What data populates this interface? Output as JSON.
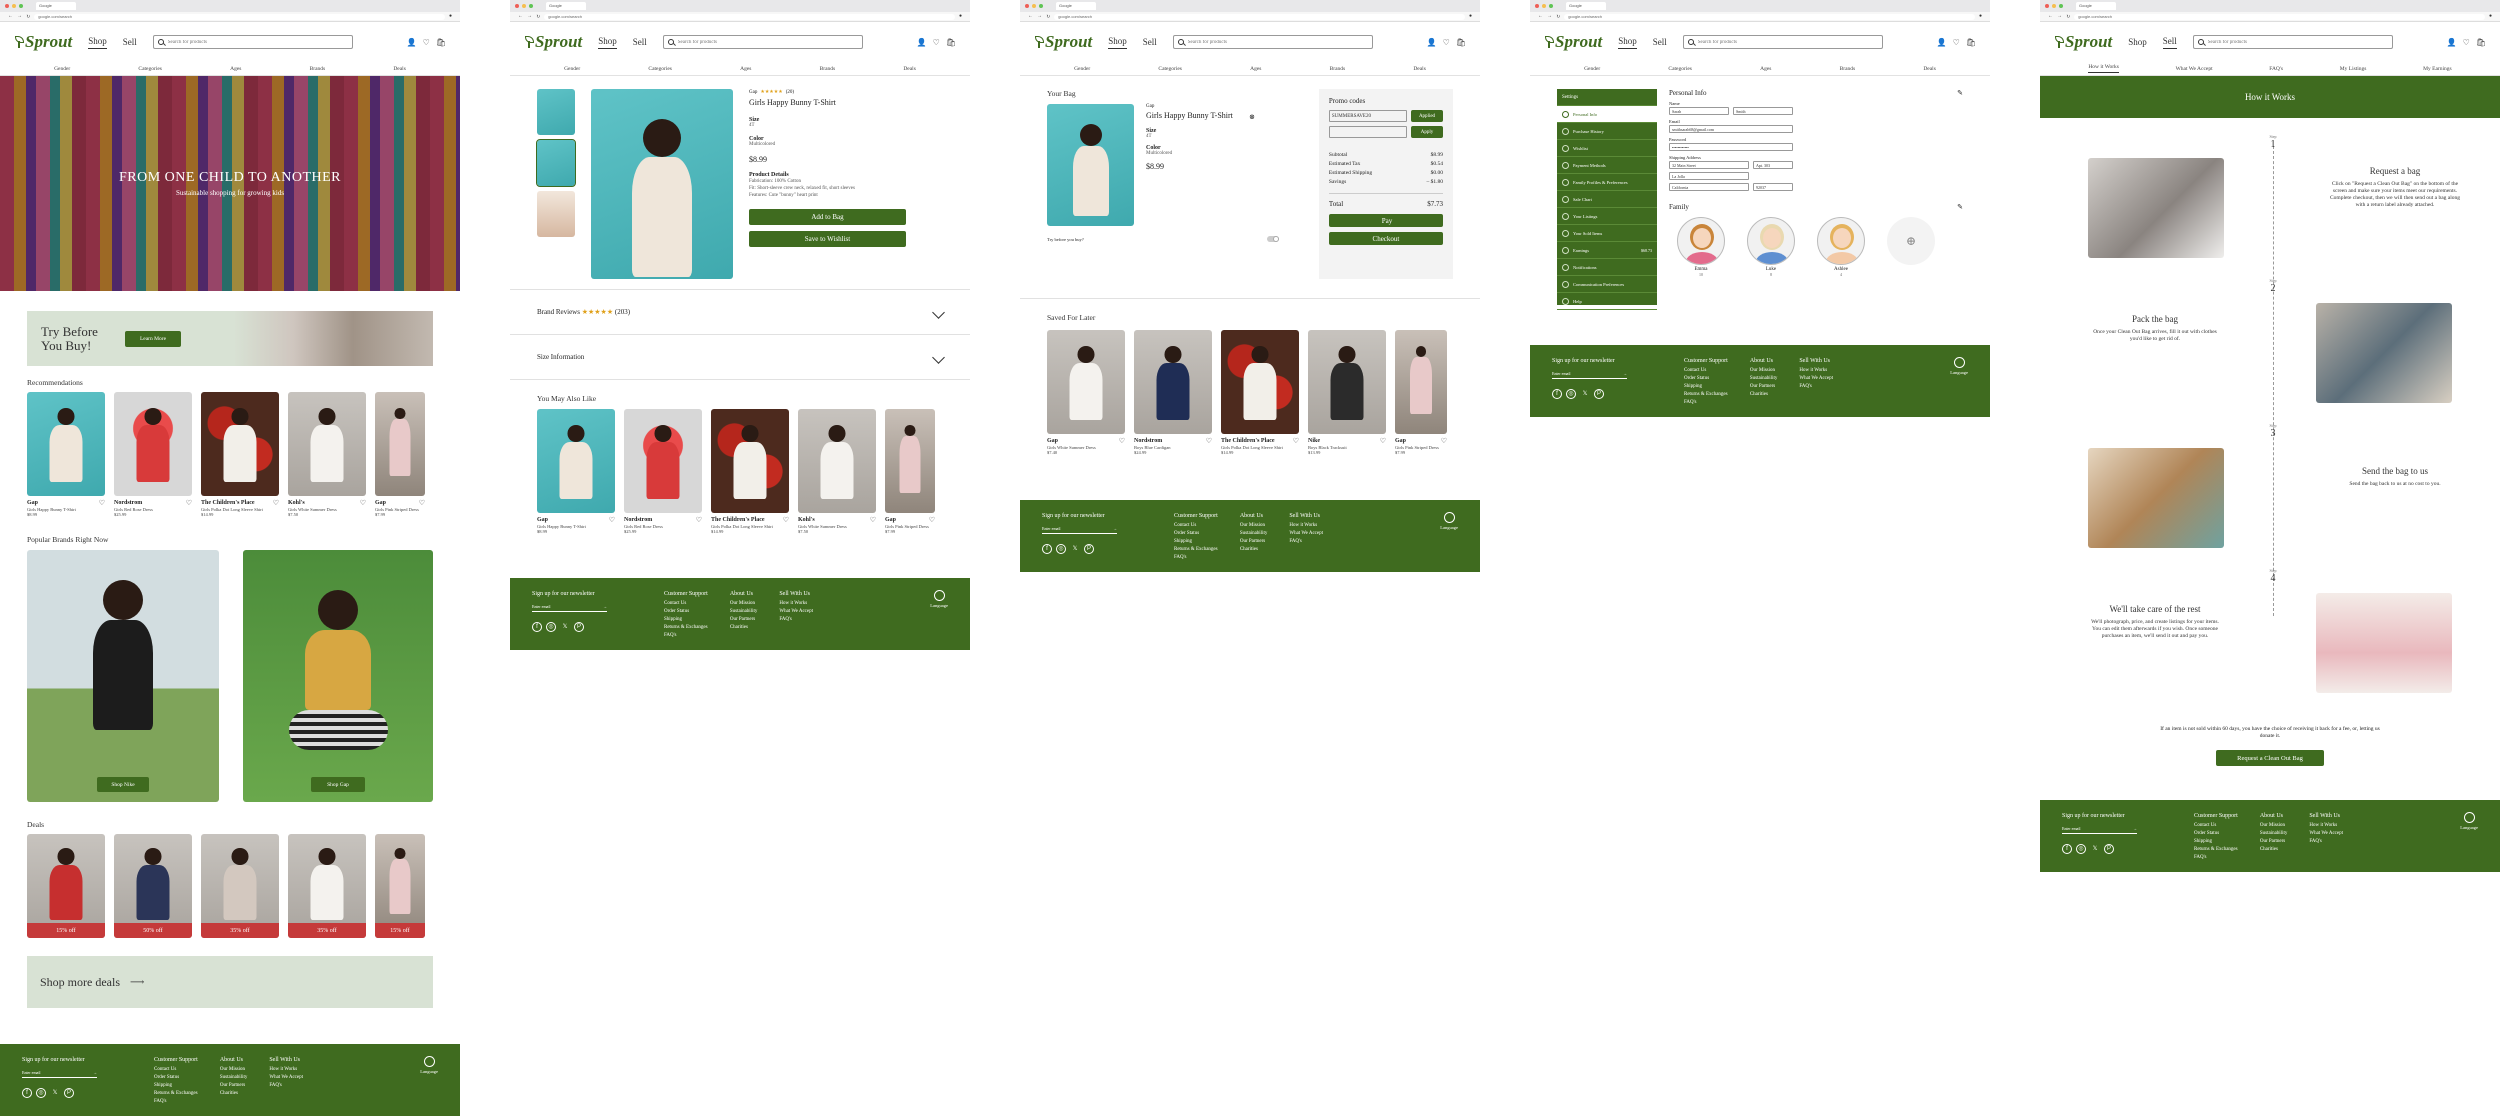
{
  "browser": {
    "tab_label": "Google",
    "url": "google.com/search"
  },
  "header": {
    "logo": "Sprout",
    "nav_shop": "Shop",
    "nav_sell": "Sell",
    "search_placeholder": "Search for products"
  },
  "category_nav": [
    "Gender",
    "Categories",
    "Ages",
    "Brands",
    "Deals"
  ],
  "sell_nav": [
    "How it Works",
    "What We Accept",
    "FAQ's",
    "My Listings",
    "My Earnings"
  ],
  "home": {
    "hero_title": "FROM ONE CHILD TO ANOTHER",
    "hero_subtitle": "Sustainable shopping for growing kids",
    "try_title": "Try Before You Buy!",
    "try_button": "Learn More",
    "recommendations_title": "Recommendations",
    "recommendations": [
      {
        "brand": "Gap",
        "name": "Girls Happy Bunny T-Shirt",
        "price": "$8.99"
      },
      {
        "brand": "Nordstrom",
        "name": "Girls Red Rose Dress",
        "price": "$25.99"
      },
      {
        "brand": "The Children's Place",
        "name": "Girls Polka Dot Long Sleeve Shirt",
        "price": "$14.99"
      },
      {
        "brand": "Kohl's",
        "name": "Girls White Summer Dress",
        "price": "$7.50"
      },
      {
        "brand": "Gap",
        "name": "Girls Pink Striped Dress",
        "price": "$7.99"
      }
    ],
    "popular_title": "Popular Brands Right Now",
    "brand_buttons": [
      "Shop Nike",
      "Shop Gap"
    ],
    "deals_title": "Deals",
    "deals": [
      "15% off",
      "50% off",
      "35% off",
      "35% off",
      "15% off"
    ],
    "shop_more": "Shop more deals"
  },
  "product": {
    "brand": "Gap",
    "rating_count": "(20)",
    "title": "Girls Happy Bunny T-Shirt",
    "size_label": "Size",
    "size_value": "4T",
    "color_label": "Color",
    "color_value": "Multicolored",
    "price": "$8.99",
    "details_label": "Product Details",
    "details": [
      "Fabrication: 100% Cotton",
      "Fit: Short-sleeve crew neck, relaxed fit, short sleeves",
      "Features: Cute \"bunny\" heart print"
    ],
    "add_to_bag": "Add to Bag",
    "save_wishlist": "Save to Wishlist",
    "brand_reviews": "Brand Reviews",
    "brand_reviews_count": "(203)",
    "size_info": "Size Information",
    "also_like_title": "You May Also Like"
  },
  "bag": {
    "title": "Your Bag",
    "brand": "Gap",
    "item_title": "Girls Happy Bunny T-Shirt",
    "size_label": "Size",
    "size_value": "4T",
    "color_label": "Color",
    "color_value": "Multicolored",
    "price": "$8.99",
    "try_label": "Try before you buy?",
    "promo_title": "Promo codes",
    "promo_code": "SUMMERSAVE20",
    "promo_applied": "Applied",
    "promo_apply": "Apply",
    "summary": [
      {
        "label": "Subtotal",
        "value": "$8.99"
      },
      {
        "label": "Estimated Tax",
        "value": "$0.54"
      },
      {
        "label": "Estimated Shipping",
        "value": "$0.00"
      },
      {
        "label": "Savings",
        "value": "– $1.80"
      }
    ],
    "total_label": "Total",
    "total_value": "$7.73",
    "apple_pay": "Pay",
    "checkout": "Checkout",
    "saved_title": "Saved For Later",
    "saved": [
      {
        "brand": "Gap",
        "name": "Girls White Summer Dress",
        "price": "$7.40"
      },
      {
        "brand": "Nordstrom",
        "name": "Boys Blue Cardigan",
        "price": "$24.99"
      },
      {
        "brand": "The Children's Place",
        "name": "Girls Polka Dot Long Sleeve Shirt",
        "price": "$14.99"
      },
      {
        "brand": "Nike",
        "name": "Boys Black Tracksuit",
        "price": "$13.99"
      },
      {
        "brand": "Gap",
        "name": "Girls Pink Striped Dress",
        "price": "$7.99"
      }
    ]
  },
  "also_like": [
    {
      "brand": "Gap",
      "name": "Girls Happy Bunny T-Shirt",
      "price": "$8.99"
    },
    {
      "brand": "Nordstrom",
      "name": "Girls Red Rose Dress",
      "price": "$25.99"
    },
    {
      "brand": "The Children's Place",
      "name": "Girls Polka Dot Long Sleeve Shirt",
      "price": "$14.99"
    },
    {
      "brand": "Kohl's",
      "name": "Girls White Summer Dress",
      "price": "$7.50"
    },
    {
      "brand": "Gap",
      "name": "Girls Pink Striped Dress",
      "price": "$7.99"
    }
  ],
  "settings": {
    "menu_title": "Settings",
    "menu": [
      "Personal Info",
      "Purchase History",
      "Wishlist",
      "Payment Methods",
      "Family Profiles & Preferences",
      "Sale Chart",
      "Your Listings",
      "Your Sold Items",
      "Earnings",
      "Notifications",
      "Communication Preferences",
      "Help"
    ],
    "earnings_amount": "$68.73",
    "personal_title": "Personal Info",
    "name_label": "Name",
    "first_name": "Sarah",
    "last_name": "Smith",
    "email_label": "Email",
    "email": "smithsarah68@gmail.com",
    "password_label": "Password",
    "password": "••••••••••••",
    "address_label": "Shipping Address",
    "street": "32 Main Street",
    "apt": "Apt. 303",
    "city": "La Jolla",
    "state": "California",
    "zip": "92037",
    "family_title": "Family",
    "family": [
      {
        "name": "Emma",
        "age": "10"
      },
      {
        "name": "Luke",
        "age": "8"
      },
      {
        "name": "Ashlee",
        "age": "4"
      }
    ]
  },
  "how": {
    "banner": "How it Works",
    "step_label": "Step",
    "steps": [
      {
        "num": "1",
        "title": "Request a bag",
        "text": "Click on \"Request a Clean Out Bag\" on the bottom of the screen and make sure your items meet our requirements. Complete checkout, then we will then send out a bag along with a return label already attached."
      },
      {
        "num": "2",
        "title": "Pack the bag",
        "text": "Once your Clean Out Bag arrives, fill it out with clothes you'd like to get rid of."
      },
      {
        "num": "3",
        "title": "Send the bag to us",
        "text": "Send the bag back to us at no cost to you."
      },
      {
        "num": "4",
        "title": "We'll take care of the rest",
        "text": "We'll photograph, price, and create listings for your items. You can edit them afterwards if you wish. Once someone purchases an item, we'll send it out and pay you."
      }
    ],
    "note": "If an item is not sold within 60 days, you have the choice of receiving it back for a fee, or, letting us donate it.",
    "cta": "Request a Clean Out Bag"
  },
  "footer": {
    "newsletter": "Sign up for our newsletter",
    "enter_email": "Enter email",
    "customer_support": "Customer Support",
    "support_links": [
      "Contact Us",
      "Order Status",
      "Shipping",
      "Returns & Exchanges",
      "FAQ's"
    ],
    "about": "About Us",
    "about_links": [
      "Our Mission",
      "Sustainability",
      "Our Partners",
      "Charities"
    ],
    "sell": "Sell With Us",
    "sell_links": [
      "How it Works",
      "What We Accept",
      "FAQ's"
    ],
    "language": "Language"
  },
  "colors": {
    "brand_green": "#3f6b1f",
    "deal_red": "#c53a3a",
    "light_green": "#d8e2d4"
  }
}
